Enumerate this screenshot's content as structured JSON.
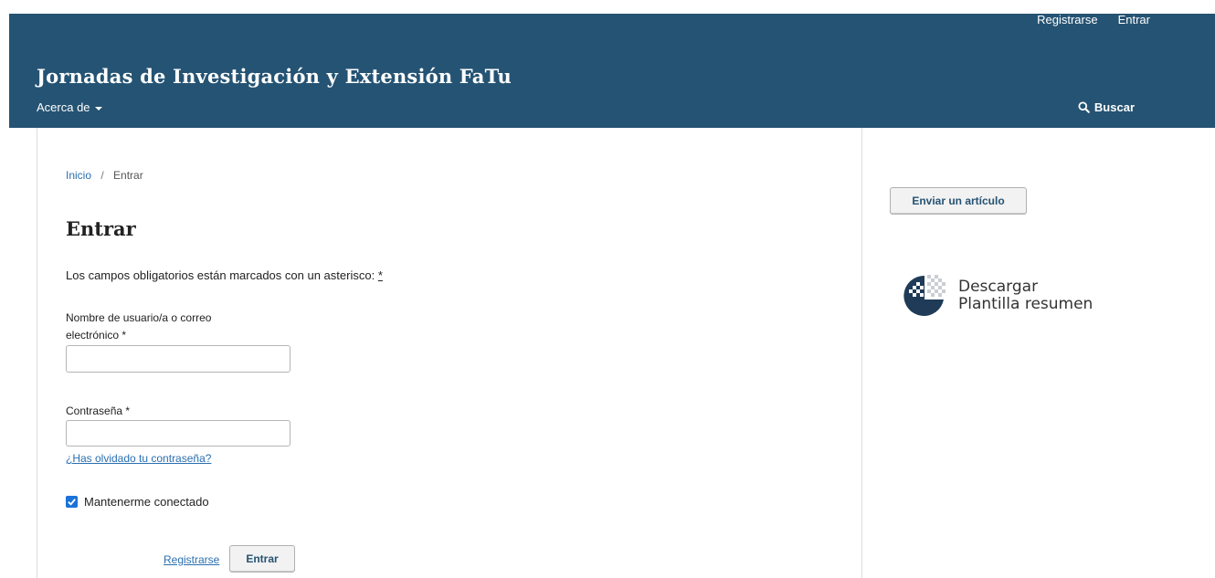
{
  "header": {
    "site_title": "Jornadas de Investigación y Extensión FaTu",
    "user_nav": {
      "register": "Registrarse",
      "login": "Entrar"
    },
    "primary_nav": {
      "about": "Acerca de"
    },
    "search": "Buscar",
    "background_color": "#255373"
  },
  "breadcrumb": {
    "home": "Inicio",
    "separator": "/",
    "current": "Entrar"
  },
  "login_form": {
    "title": "Entrar",
    "required_note": "Los campos obligatorios están marcados con un asterisco:",
    "required_marker": "*",
    "username_label": "Nombre de usuario/a o correo electrónico *",
    "username_value": "",
    "password_label": "Contraseña *",
    "password_value": "",
    "forgot_password": "¿Has olvidado tu contraseña?",
    "remember_me": "Mantenerme conectado",
    "remember_me_checked": true,
    "register_link": "Registrarse",
    "submit": "Entrar"
  },
  "sidebar": {
    "submit_article": "Enviar un artículo",
    "download_line1": "Descargar",
    "download_line2": "Plantilla resumen"
  },
  "colors": {
    "link": "#2a6fb0",
    "checkbox": "#1a73d9",
    "button_text": "#255373"
  }
}
